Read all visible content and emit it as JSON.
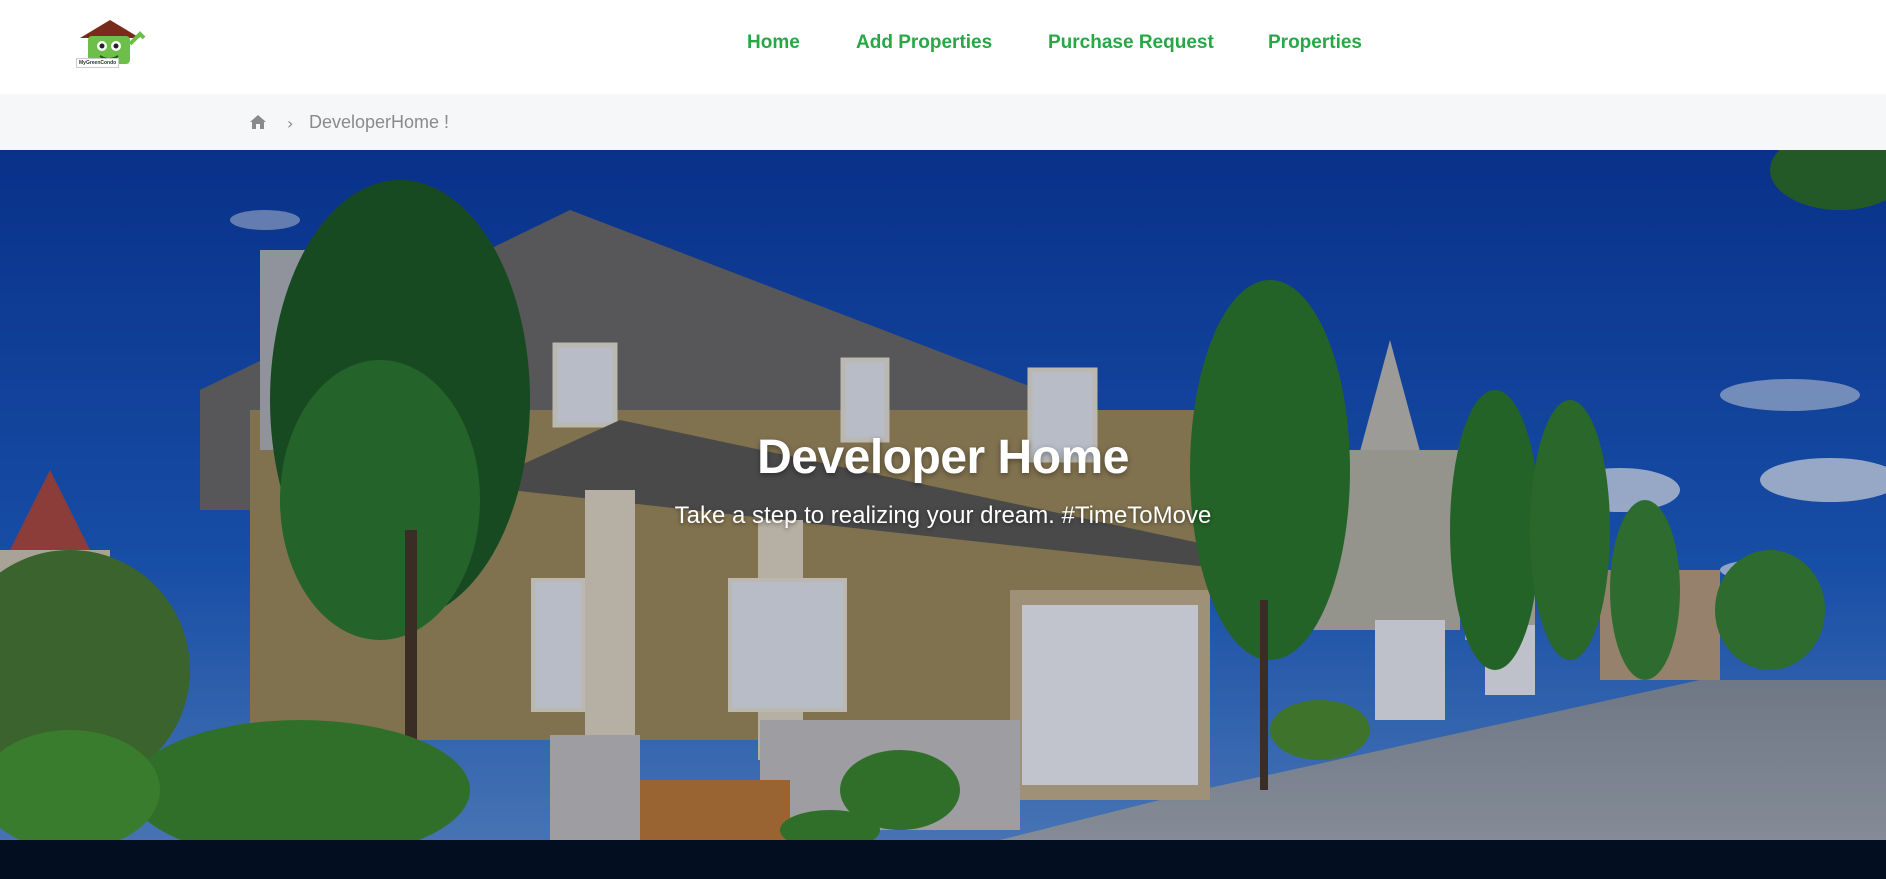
{
  "brand": {
    "logo_text": "MyGreenCondo"
  },
  "nav": {
    "items": [
      {
        "label": "Home"
      },
      {
        "label": "Add Properties"
      },
      {
        "label": "Purchase Request"
      },
      {
        "label": "Properties"
      }
    ]
  },
  "breadcrumb": {
    "home_icon": "home-icon",
    "separator_icon": "chevron-right-icon",
    "current": "DeveloperHome !"
  },
  "hero": {
    "title": "Developer Home",
    "subtitle": "Take a step to realizing your dream. #TimeToMove"
  },
  "colors": {
    "nav_link": "#28a745",
    "breadcrumb_bg": "#f6f7f9",
    "footer_bar": "#030f21"
  }
}
